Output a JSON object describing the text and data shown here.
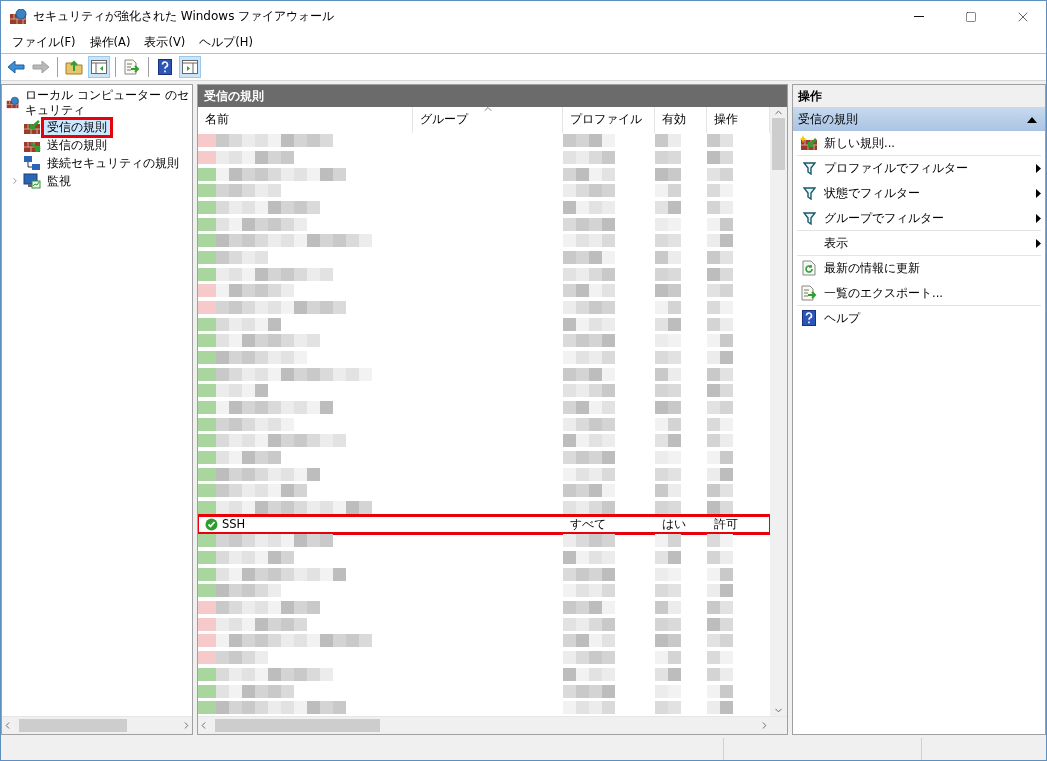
{
  "window": {
    "title": "セキュリティが強化された Windows ファイアウォール"
  },
  "menu": [
    "ファイル(F)",
    "操作(A)",
    "表示(V)",
    "ヘルプ(H)"
  ],
  "toolbar": [
    [
      {
        "kind": "back",
        "disabled": false,
        "pressed": false
      },
      {
        "kind": "forward",
        "disabled": true,
        "pressed": false
      }
    ],
    [
      {
        "kind": "up",
        "disabled": false,
        "pressed": false
      },
      {
        "kind": "tree",
        "disabled": false,
        "pressed": true
      }
    ],
    [
      {
        "kind": "export",
        "disabled": false,
        "pressed": false
      }
    ],
    [
      {
        "kind": "help",
        "disabled": false,
        "pressed": false
      },
      {
        "kind": "actions",
        "disabled": false,
        "pressed": true
      }
    ]
  ],
  "tree": {
    "items": [
      {
        "label": "ローカル コンピューター のセキュリティ",
        "kind": "root",
        "expanded": true,
        "selected": false,
        "highlighted": false,
        "children": [
          {
            "label": "受信の規則",
            "kind": "inbound",
            "selected": true,
            "highlighted": true
          },
          {
            "label": "送信の規則",
            "kind": "outbound",
            "selected": false,
            "highlighted": false
          },
          {
            "label": "接続セキュリティの規則",
            "kind": "connection",
            "selected": false,
            "highlighted": false
          },
          {
            "label": "監視",
            "kind": "monitor",
            "selected": false,
            "highlighted": false,
            "expanded": false
          }
        ]
      }
    ]
  },
  "list": {
    "title": "受信の規則",
    "columns": [
      {
        "label": "名前",
        "sorted": false
      },
      {
        "label": "グループ",
        "sorted": true
      },
      {
        "label": "プロファイル",
        "sorted": false
      },
      {
        "label": "有効",
        "sorted": false
      },
      {
        "label": "操作",
        "sorted": false
      }
    ],
    "rows": [
      {
        "kind": "redacted",
        "color": "#f6caca"
      },
      {
        "kind": "redacted",
        "color": "#f6caca"
      },
      {
        "kind": "redacted",
        "color": "#a8d69e"
      },
      {
        "kind": "redacted",
        "color": "#a8d69e"
      },
      {
        "kind": "redacted",
        "color": "#a8d69e"
      },
      {
        "kind": "redacted",
        "color": "#a8d69e"
      },
      {
        "kind": "redacted",
        "color": "#a8d69e"
      },
      {
        "kind": "redacted",
        "color": "#a8d69e"
      },
      {
        "kind": "redacted",
        "color": "#a8d69e"
      },
      {
        "kind": "redacted",
        "color": "#f6caca"
      },
      {
        "kind": "redacted",
        "color": "#f6caca"
      },
      {
        "kind": "redacted",
        "color": "#a8d69e"
      },
      {
        "kind": "redacted",
        "color": "#a8d69e"
      },
      {
        "kind": "redacted",
        "color": "#a8d69e"
      },
      {
        "kind": "redacted",
        "color": "#a8d69e"
      },
      {
        "kind": "redacted",
        "color": "#a8d69e"
      },
      {
        "kind": "redacted",
        "color": "#a8d69e"
      },
      {
        "kind": "redacted",
        "color": "#a8d69e"
      },
      {
        "kind": "redacted",
        "color": "#a8d69e"
      },
      {
        "kind": "redacted",
        "color": "#a8d69e"
      },
      {
        "kind": "redacted",
        "color": "#a8d69e"
      },
      {
        "kind": "redacted",
        "color": "#a8d69e"
      },
      {
        "kind": "redacted",
        "color": "#a8d69e"
      },
      {
        "kind": "rule",
        "name": "SSH",
        "profile": "すべて",
        "enabled": "はい",
        "action": "許可",
        "highlighted": true
      },
      {
        "kind": "redacted",
        "color": "#a8d69e"
      },
      {
        "kind": "redacted",
        "color": "#a8d69e"
      },
      {
        "kind": "redacted",
        "color": "#a8d69e"
      },
      {
        "kind": "redacted",
        "color": "#a8d69e"
      },
      {
        "kind": "redacted",
        "color": "#f6caca"
      },
      {
        "kind": "redacted",
        "color": "#f6caca"
      },
      {
        "kind": "redacted",
        "color": "#f6caca"
      },
      {
        "kind": "redacted",
        "color": "#f6caca"
      },
      {
        "kind": "redacted",
        "color": "#a8d69e"
      },
      {
        "kind": "redacted",
        "color": "#a8d69e"
      },
      {
        "kind": "redacted",
        "color": "#a8d69e"
      }
    ]
  },
  "actions": {
    "title": "操作",
    "section": {
      "label": "受信の規則",
      "expanded": true
    },
    "items": [
      {
        "label": "新しい規則...",
        "kind": "new",
        "submenu": false,
        "divider_after": true
      },
      {
        "label": "プロファイルでフィルター",
        "kind": "filter",
        "submenu": true,
        "divider_after": false
      },
      {
        "label": "状態でフィルター",
        "kind": "filter",
        "submenu": true,
        "divider_after": false
      },
      {
        "label": "グループでフィルター",
        "kind": "filter",
        "submenu": true,
        "divider_after": true
      },
      {
        "label": "表示",
        "kind": "none",
        "submenu": true,
        "divider_after": true
      },
      {
        "label": "最新の情報に更新",
        "kind": "refresh",
        "submenu": false,
        "divider_after": false
      },
      {
        "label": "一覧のエクスポート...",
        "kind": "export",
        "submenu": false,
        "divider_after": true
      },
      {
        "label": "ヘルプ",
        "kind": "help",
        "submenu": false,
        "divider_after": false
      }
    ]
  }
}
